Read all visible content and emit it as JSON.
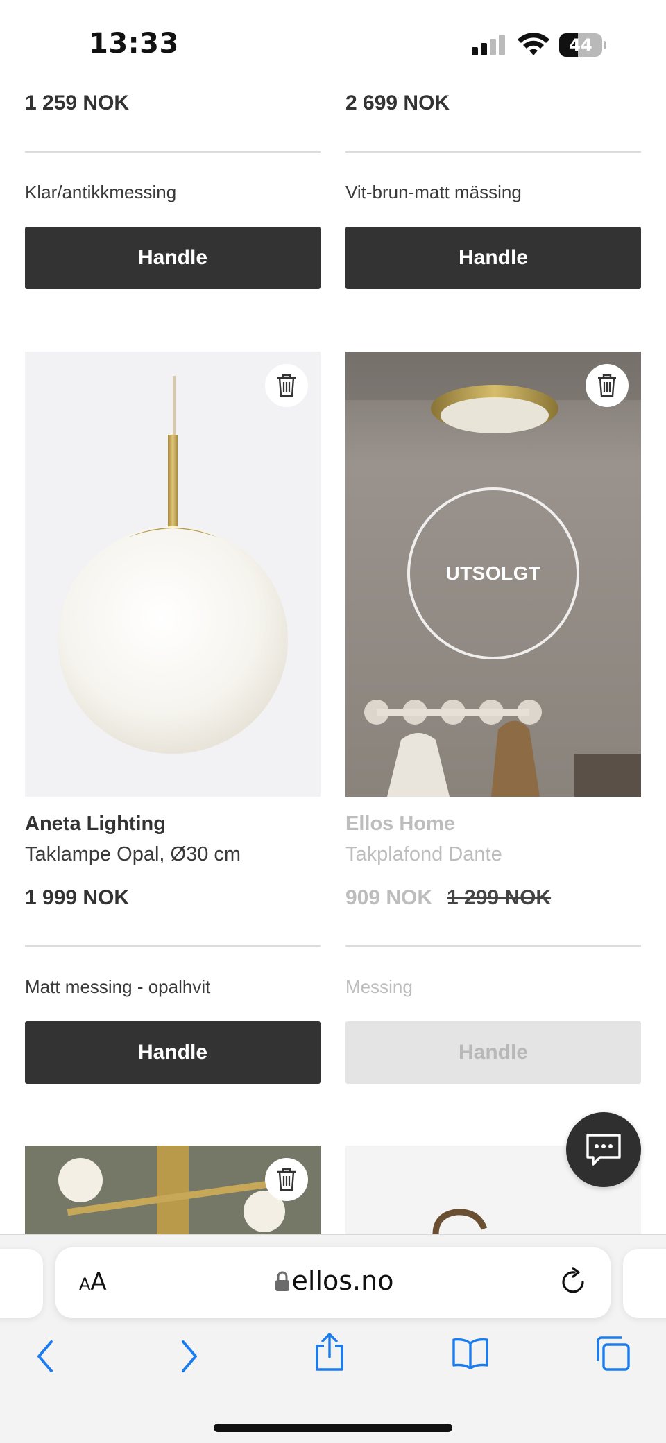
{
  "status_bar": {
    "time": "13:33",
    "battery": "44",
    "battery_level": 0.44
  },
  "products_top": [
    {
      "price": "1 259 NOK",
      "variant": "Klar/antikkmessing",
      "button": "Handle"
    },
    {
      "price": "2 699 NOK",
      "variant": "Vit-brun-matt mässing",
      "button": "Handle"
    }
  ],
  "products_middle": [
    {
      "brand": "Aneta Lighting",
      "name": "Taklampe Opal, Ø30 cm",
      "price": "1 999 NOK",
      "variant": "Matt messing - opalhvit",
      "button": "Handle"
    },
    {
      "brand": "Ellos Home",
      "name": "Takplafond Dante",
      "price": "909 NOK",
      "old_price": "1 299 NOK",
      "variant": "Messing",
      "button": "Handle",
      "badge": "UTSOLGT"
    }
  ],
  "browser": {
    "text_size": "AA",
    "url": "ellos.no"
  },
  "colors": {
    "button_dark": "#333333",
    "button_disabled": "#e4e4e4",
    "ios_blue": "#1a7cf0"
  }
}
